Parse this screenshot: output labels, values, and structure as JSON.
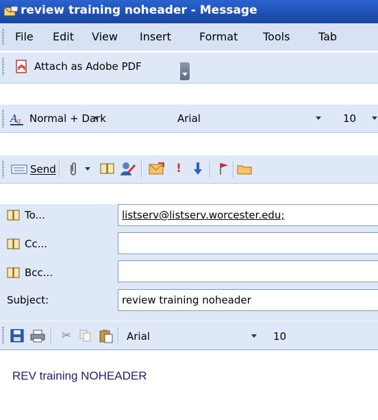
{
  "window": {
    "title": "review training noheader - Message"
  },
  "menu": [
    "File",
    "Edit",
    "View",
    "Insert",
    "Format",
    "Tools",
    "Tab"
  ],
  "pdf_toolbar": {
    "attach_label": "Attach as Adobe PDF"
  },
  "format_toolbar": {
    "style": "Normal + Dark",
    "font": "Arial",
    "size": "10"
  },
  "send_toolbar": {
    "send_label": "Send"
  },
  "fields": {
    "to_label": "To...",
    "to_value": "listserv@listserv.worcester.edu;",
    "cc_label": "Cc...",
    "cc_value": "",
    "bcc_label": "Bcc...",
    "bcc_value": "",
    "subject_label": "Subject:",
    "subject_value": "review training noheader"
  },
  "body_toolbar": {
    "font": "Arial",
    "size": "10"
  },
  "body": {
    "text": "REV training NOHEADER"
  },
  "colors": {
    "title_bar": "#1e4fb0",
    "toolbar": "#dfe8f6",
    "body_text": "#20206e"
  }
}
